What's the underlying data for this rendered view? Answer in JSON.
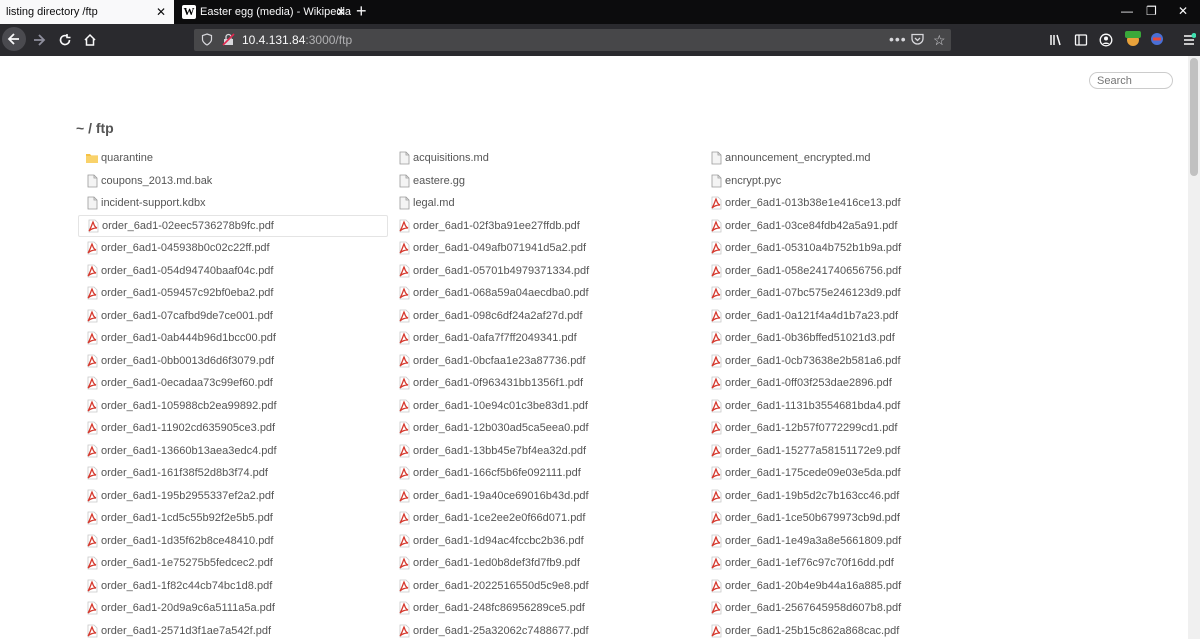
{
  "browser": {
    "tabs": [
      {
        "title": "listing directory /ftp",
        "active": true
      },
      {
        "title": "Easter egg (media) - Wikipedia",
        "active": false
      }
    ],
    "url": {
      "host": "10.4.131.84",
      "rest": ":3000/ftp"
    }
  },
  "page": {
    "search_placeholder": "Search",
    "heading": "~ / ftp",
    "files": [
      {
        "name": "quarantine",
        "type": "folder"
      },
      {
        "name": "acquisitions.md",
        "type": "file"
      },
      {
        "name": "announcement_encrypted.md",
        "type": "file"
      },
      {
        "name": "coupons_2013.md.bak",
        "type": "file"
      },
      {
        "name": "eastere.gg",
        "type": "file"
      },
      {
        "name": "encrypt.pyc",
        "type": "file"
      },
      {
        "name": "incident-support.kdbx",
        "type": "file"
      },
      {
        "name": "legal.md",
        "type": "file"
      },
      {
        "name": "order_6ad1-013b38e1e416ce13.pdf",
        "type": "pdf"
      },
      {
        "name": "order_6ad1-02eec5736278b9fc.pdf",
        "type": "pdf"
      },
      {
        "name": "order_6ad1-02f3ba91ee27ffdb.pdf",
        "type": "pdf"
      },
      {
        "name": "order_6ad1-03ce84fdb42a5a91.pdf",
        "type": "pdf"
      },
      {
        "name": "order_6ad1-045938b0c02c22ff.pdf",
        "type": "pdf"
      },
      {
        "name": "order_6ad1-049afb071941d5a2.pdf",
        "type": "pdf"
      },
      {
        "name": "order_6ad1-05310a4b752b1b9a.pdf",
        "type": "pdf"
      },
      {
        "name": "order_6ad1-054d94740baaf04c.pdf",
        "type": "pdf"
      },
      {
        "name": "order_6ad1-05701b4979371334.pdf",
        "type": "pdf"
      },
      {
        "name": "order_6ad1-058e241740656756.pdf",
        "type": "pdf"
      },
      {
        "name": "order_6ad1-059457c92bf0eba2.pdf",
        "type": "pdf"
      },
      {
        "name": "order_6ad1-068a59a04aecdba0.pdf",
        "type": "pdf"
      },
      {
        "name": "order_6ad1-07bc575e246123d9.pdf",
        "type": "pdf"
      },
      {
        "name": "order_6ad1-07cafbd9de7ce001.pdf",
        "type": "pdf"
      },
      {
        "name": "order_6ad1-098c6df24a2af27d.pdf",
        "type": "pdf"
      },
      {
        "name": "order_6ad1-0a121f4a4d1b7a23.pdf",
        "type": "pdf"
      },
      {
        "name": "order_6ad1-0ab444b96d1bcc00.pdf",
        "type": "pdf"
      },
      {
        "name": "order_6ad1-0afa7f7ff2049341.pdf",
        "type": "pdf"
      },
      {
        "name": "order_6ad1-0b36bffed51021d3.pdf",
        "type": "pdf"
      },
      {
        "name": "order_6ad1-0bb0013d6d6f3079.pdf",
        "type": "pdf"
      },
      {
        "name": "order_6ad1-0bcfaa1e23a87736.pdf",
        "type": "pdf"
      },
      {
        "name": "order_6ad1-0cb73638e2b581a6.pdf",
        "type": "pdf"
      },
      {
        "name": "order_6ad1-0ecadaa73c99ef60.pdf",
        "type": "pdf"
      },
      {
        "name": "order_6ad1-0f963431bb1356f1.pdf",
        "type": "pdf"
      },
      {
        "name": "order_6ad1-0ff03f253dae2896.pdf",
        "type": "pdf"
      },
      {
        "name": "order_6ad1-105988cb2ea99892.pdf",
        "type": "pdf"
      },
      {
        "name": "order_6ad1-10e94c01c3be83d1.pdf",
        "type": "pdf"
      },
      {
        "name": "order_6ad1-1131b3554681bda4.pdf",
        "type": "pdf"
      },
      {
        "name": "order_6ad1-11902cd635905ce3.pdf",
        "type": "pdf"
      },
      {
        "name": "order_6ad1-12b030ad5ca5eea0.pdf",
        "type": "pdf"
      },
      {
        "name": "order_6ad1-12b57f0772299cd1.pdf",
        "type": "pdf"
      },
      {
        "name": "order_6ad1-13660b13aea3edc4.pdf",
        "type": "pdf"
      },
      {
        "name": "order_6ad1-13bb45e7bf4ea32d.pdf",
        "type": "pdf"
      },
      {
        "name": "order_6ad1-15277a58151172e9.pdf",
        "type": "pdf"
      },
      {
        "name": "order_6ad1-161f38f52d8b3f74.pdf",
        "type": "pdf"
      },
      {
        "name": "order_6ad1-166cf5b6fe092111.pdf",
        "type": "pdf"
      },
      {
        "name": "order_6ad1-175cede09e03e5da.pdf",
        "type": "pdf"
      },
      {
        "name": "order_6ad1-195b2955337ef2a2.pdf",
        "type": "pdf"
      },
      {
        "name": "order_6ad1-19a40ce69016b43d.pdf",
        "type": "pdf"
      },
      {
        "name": "order_6ad1-19b5d2c7b163cc46.pdf",
        "type": "pdf"
      },
      {
        "name": "order_6ad1-1cd5c55b92f2e5b5.pdf",
        "type": "pdf"
      },
      {
        "name": "order_6ad1-1ce2ee2e0f66d071.pdf",
        "type": "pdf"
      },
      {
        "name": "order_6ad1-1ce50b679973cb9d.pdf",
        "type": "pdf"
      },
      {
        "name": "order_6ad1-1d35f62b8ce48410.pdf",
        "type": "pdf"
      },
      {
        "name": "order_6ad1-1d94ac4fccbc2b36.pdf",
        "type": "pdf"
      },
      {
        "name": "order_6ad1-1e49a3a8e5661809.pdf",
        "type": "pdf"
      },
      {
        "name": "order_6ad1-1e75275b5fedcec2.pdf",
        "type": "pdf"
      },
      {
        "name": "order_6ad1-1ed0b8def3fd7fb9.pdf",
        "type": "pdf"
      },
      {
        "name": "order_6ad1-1ef76c97c70f16dd.pdf",
        "type": "pdf"
      },
      {
        "name": "order_6ad1-1f82c44cb74bc1d8.pdf",
        "type": "pdf"
      },
      {
        "name": "order_6ad1-2022516550d5c9e8.pdf",
        "type": "pdf"
      },
      {
        "name": "order_6ad1-20b4e9b44a16a885.pdf",
        "type": "pdf"
      },
      {
        "name": "order_6ad1-20d9a9c6a5111a5a.pdf",
        "type": "pdf"
      },
      {
        "name": "order_6ad1-248fc86956289ce5.pdf",
        "type": "pdf"
      },
      {
        "name": "order_6ad1-2567645958d607b8.pdf",
        "type": "pdf"
      },
      {
        "name": "order_6ad1-2571d3f1ae7a542f.pdf",
        "type": "pdf"
      },
      {
        "name": "order_6ad1-25a32062c7488677.pdf",
        "type": "pdf"
      },
      {
        "name": "order_6ad1-25b15c862a868cac.pdf",
        "type": "pdf"
      }
    ]
  }
}
